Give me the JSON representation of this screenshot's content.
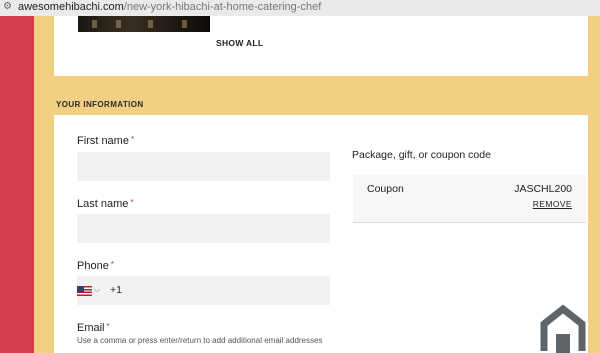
{
  "browser": {
    "url_domain": "awesomehibachi.com",
    "url_path": "/new-york-hibachi-at-home-catering-chef",
    "site_icon": "site-settings-icon"
  },
  "top_card": {
    "show_all_label": "SHOW ALL"
  },
  "section": {
    "title": "YOUR INFORMATION"
  },
  "form": {
    "first_name_label": "First name",
    "last_name_label": "Last name",
    "phone_label": "Phone",
    "phone_dial_code": "+1",
    "phone_country_icon": "us-flag-icon",
    "email_label": "Email",
    "email_hint": "Use a comma or press enter/return to add additional email addresses",
    "required_marker": "*"
  },
  "coupon": {
    "heading": "Package, gift, or coupon code",
    "label": "Coupon",
    "code": "JASCHL200",
    "remove_label": "REMOVE"
  },
  "colors": {
    "red_band": "#d33d4e",
    "gold_band": "#f2cf82",
    "field_bg": "#f1f1f1"
  }
}
